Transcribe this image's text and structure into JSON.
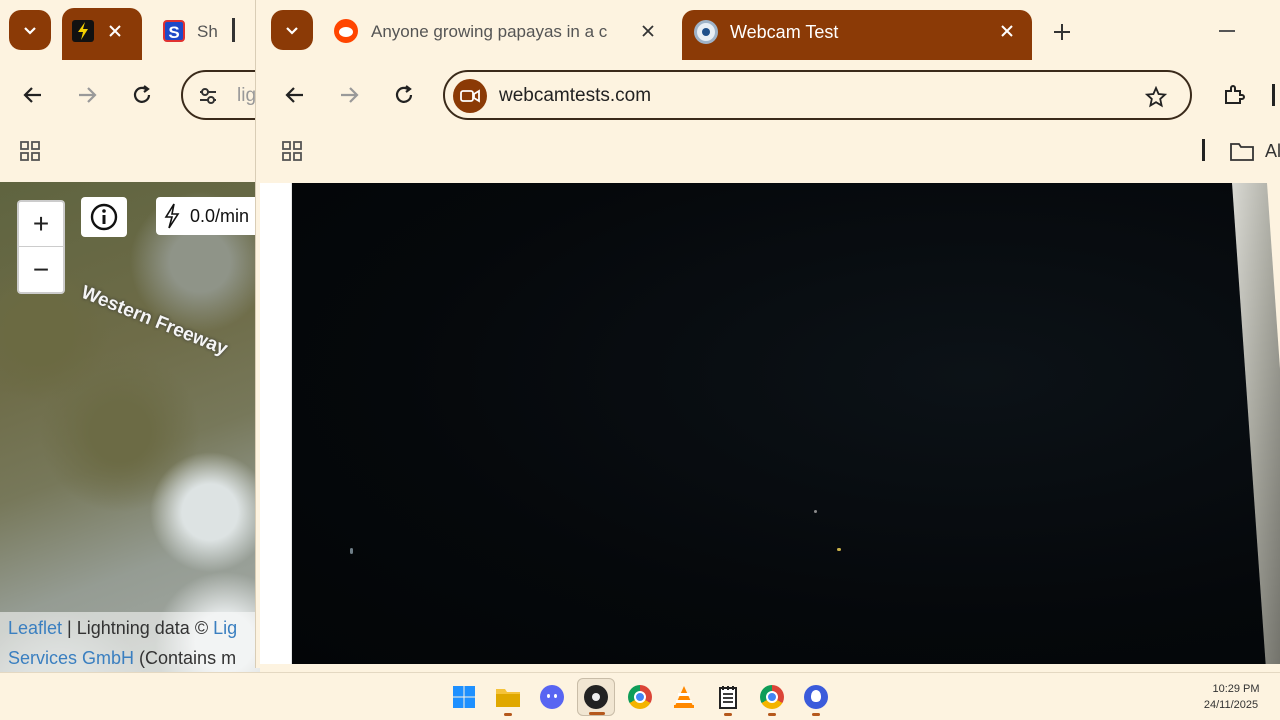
{
  "back_window": {
    "tab_active_icon": "lightning-bolt-icon",
    "tab_2_label": "Sh",
    "url_fragment": "lig",
    "map": {
      "road_label": "Western Freeway",
      "rate_label": "0.0/min",
      "attribution_link_1": "Leaflet",
      "attribution_text_1": " | Lightning data © ",
      "attribution_link_2": "Lig",
      "attribution_link_3": "Services GmbH",
      "attribution_text_2": " (Contains m"
    }
  },
  "front_window": {
    "tabs": [
      {
        "label": "Anyone growing papayas in a c",
        "icon": "reddit-icon"
      },
      {
        "label": "Webcam Test",
        "icon": "webcam-test-icon"
      }
    ],
    "url": "webcamtests.com",
    "bookmarks_fragment": "Al"
  },
  "taskbar": {
    "apps": [
      "windows-start-icon",
      "file-explorer-icon",
      "discord-icon",
      "obs-icon",
      "chrome-icon",
      "vlc-icon",
      "notepad-icon",
      "chrome-icon",
      "app-icon"
    ],
    "time": "10:29 PM",
    "date": "24/11/2025"
  },
  "colors": {
    "accent": "#8b3a06",
    "background": "#fdf3e0",
    "video": "#05080b",
    "link": "#3a7fc0"
  }
}
